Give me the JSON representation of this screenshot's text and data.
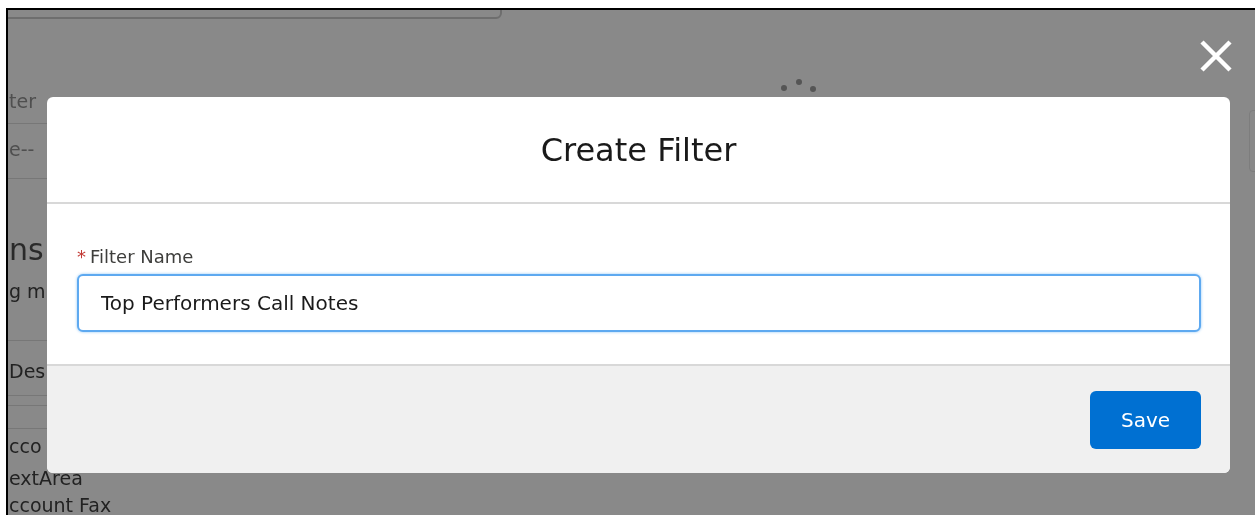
{
  "background": {
    "fragments": [
      {
        "text": "ter",
        "kind": "faint"
      },
      {
        "text": "e--",
        "kind": "faint"
      },
      {
        "text": "ns",
        "kind": "heading"
      },
      {
        "text": "g m",
        "kind": "text"
      },
      {
        "text": "Des",
        "kind": "text"
      },
      {
        "text": "cco",
        "kind": "text"
      },
      {
        "text": "extArea",
        "kind": "text"
      },
      {
        "text": "ccount Fax",
        "kind": "text"
      }
    ]
  },
  "modal": {
    "title": "Create Filter",
    "field": {
      "label": "Filter Name",
      "required_mark": "*",
      "value": "Top Performers Call Notes"
    },
    "buttons": [
      "Save"
    ]
  }
}
